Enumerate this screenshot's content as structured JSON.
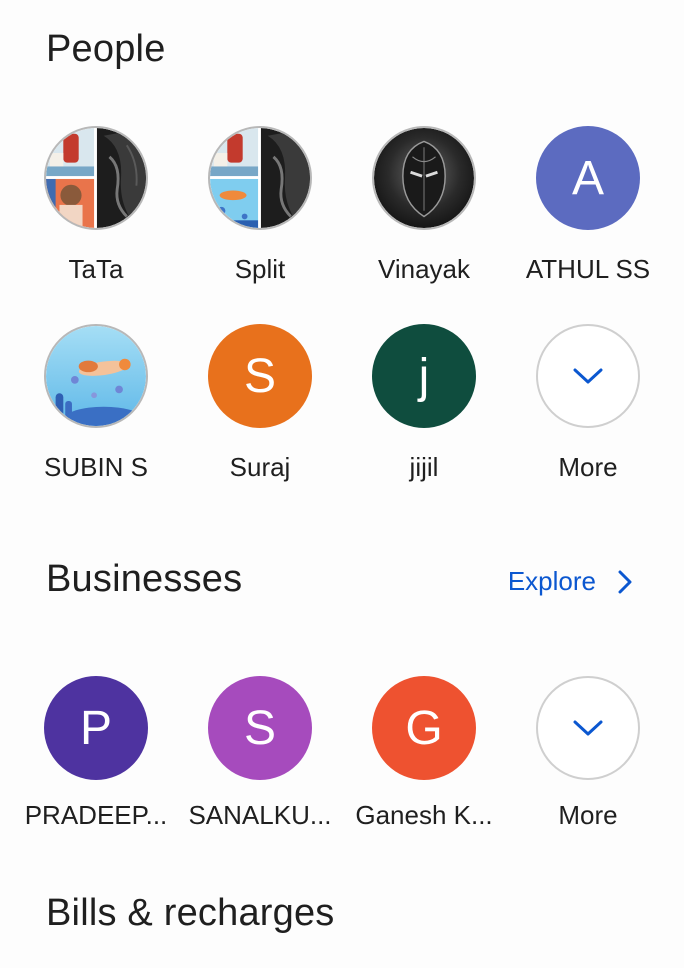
{
  "people": {
    "title": "People",
    "items": [
      {
        "name": "TaTa",
        "type": "photo-group"
      },
      {
        "name": "Split",
        "type": "photo-group"
      },
      {
        "name": "Vinayak",
        "type": "photo"
      },
      {
        "name": "ATHUL SS",
        "initial": "A",
        "color": "#5c6bc0"
      },
      {
        "name": "SUBIN S",
        "type": "photo"
      },
      {
        "name": "Suraj",
        "initial": "S",
        "color": "#e8711c"
      },
      {
        "name": "jijil",
        "initial": "j",
        "color": "#0f4d3e"
      }
    ],
    "more_label": "More"
  },
  "businesses": {
    "title": "Businesses",
    "explore_label": "Explore",
    "items": [
      {
        "name": "PRADEEP...",
        "initial": "P",
        "color": "#4e33a0"
      },
      {
        "name": "SANALKU...",
        "initial": "S",
        "color": "#a64bbd"
      },
      {
        "name": "Ganesh K...",
        "initial": "G",
        "color": "#ee5230"
      }
    ],
    "more_label": "More"
  },
  "bills": {
    "title": "Bills & recharges"
  },
  "icons": {
    "more": "chevron-down-icon",
    "explore": "chevron-right-icon"
  },
  "colors": {
    "accent": "#0b57d0",
    "text": "#1f1f1f"
  }
}
